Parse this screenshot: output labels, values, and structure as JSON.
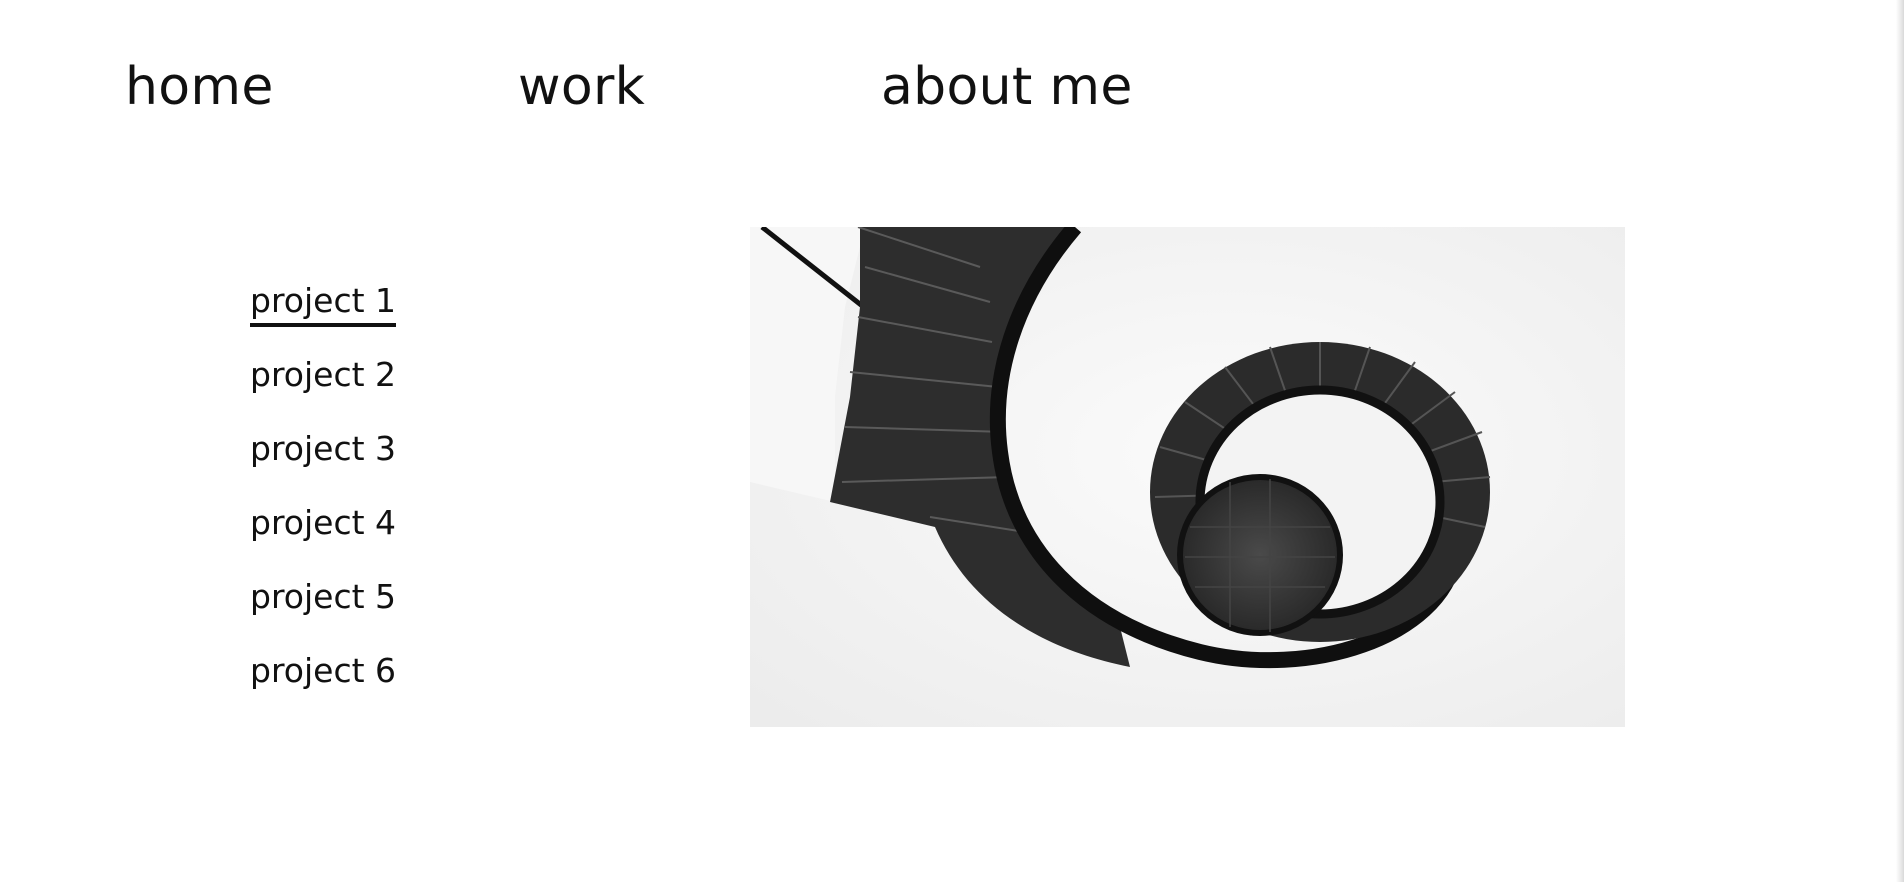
{
  "nav": {
    "home": "home",
    "work": "work",
    "about": "about me"
  },
  "projects": [
    {
      "label": "project 1",
      "active": true
    },
    {
      "label": "project 2",
      "active": false
    },
    {
      "label": "project 3",
      "active": false
    },
    {
      "label": "project 4",
      "active": false
    },
    {
      "label": "project 5",
      "active": false
    },
    {
      "label": "project 6",
      "active": false
    }
  ],
  "hero": {
    "subject": "spiral staircase, black and white photograph"
  },
  "colors": {
    "text": "#111111",
    "background": "#ffffff",
    "image_background": "#f0f0f0",
    "stair_dark": "#2e2e2e"
  }
}
